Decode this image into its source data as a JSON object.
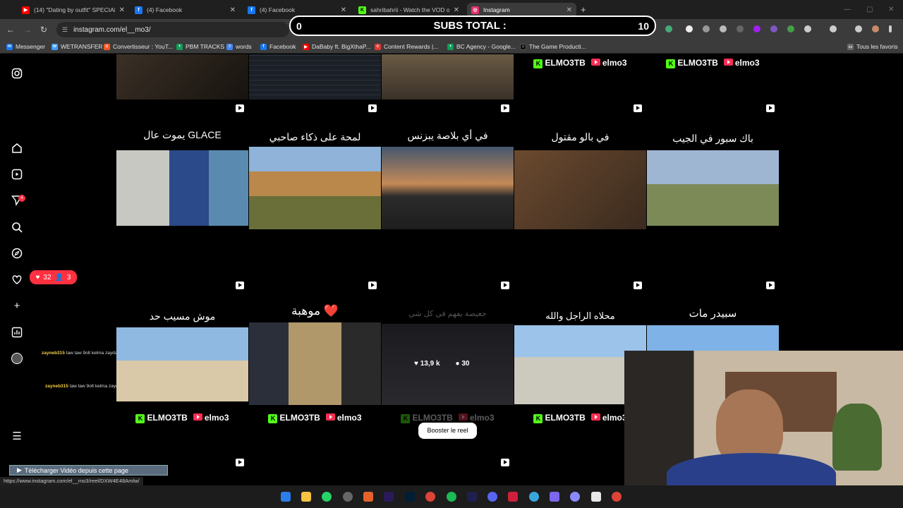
{
  "tabs": [
    {
      "title": "(14) \"Dating by outfit\" SPECIAL",
      "favicon_color": "#ff0000",
      "active": false
    },
    {
      "title": "(4) Facebook",
      "favicon_color": "#1877f2",
      "active": false
    },
    {
      "title": "(4) Facebook",
      "favicon_color": "#1877f2",
      "active": false
    },
    {
      "title": "sahribahrii - Watch the VOD on",
      "favicon_color": "#53fc18",
      "active": false
    },
    {
      "title": "Instagram",
      "favicon_color": "#e1306c",
      "active": true
    }
  ],
  "url": "instagram.com/el__mo3/",
  "subs_overlay": {
    "left": "0",
    "label": "SUBS TOTAL :",
    "right": "10"
  },
  "bookmarks": [
    {
      "label": "Messenger",
      "color": "#1877f2"
    },
    {
      "label": "WETRANSFER",
      "color": "#409fff"
    },
    {
      "label": "Convertisseur : YouT...",
      "color": "#ff5722"
    },
    {
      "label": "PBM TRACKS",
      "color": "#0f9d58"
    },
    {
      "label": "words",
      "color": "#4285f4"
    },
    {
      "label": "Facebook",
      "color": "#1877f2"
    },
    {
      "label": "DaBaby ft. BigXthaP...",
      "color": "#ff0000"
    },
    {
      "label": "Content Rewards |...",
      "color": "#e53935"
    },
    {
      "label": "BC Agency - Google...",
      "color": "#0f9d58"
    },
    {
      "label": "The Game Producti...",
      "color": "#111111"
    }
  ],
  "all_bookmarks": "Tous les favoris",
  "notif_pill": {
    "likes": "32",
    "followers": "3"
  },
  "sidebar_badge": "4",
  "brand": {
    "kick": "ELMO3TB",
    "yt": "elmo3"
  },
  "posts_row1": [
    {
      "caption": ""
    },
    {
      "caption": ""
    },
    {
      "caption": ""
    },
    {
      "caption": ""
    },
    {
      "caption": ""
    }
  ],
  "posts_row2": [
    {
      "caption": "يموت عال GLACE"
    },
    {
      "caption": "لمحة على ذكاء صاحبي"
    },
    {
      "caption": "في أي بلاصة يبزنس"
    },
    {
      "caption": "في بالو مقتول"
    },
    {
      "caption": "باك سبور في الجيب"
    }
  ],
  "posts_row3": [
    {
      "caption": "موش مسيب حد"
    },
    {
      "caption": "موهبة ❤️"
    },
    {
      "caption": "جعيصة يفهم في كل شي"
    },
    {
      "caption": "محلاه الراجل والله"
    },
    {
      "caption": "سبيدر مات"
    }
  ],
  "hover_stats": {
    "likes": "13,9 k",
    "comments": "30"
  },
  "boost_label": "Booster le reel",
  "chat": [
    {
      "user": "zayneb315",
      "msg": "taw taw 9olt kelma zaydaaa"
    },
    {
      "user": "zayneb315",
      "msg": "taw taw 9olt kelma zaydaaa"
    }
  ],
  "download_bar": "Télécharger Vidéo depuis cette page",
  "status_url": "https://www.instagram.com/el__mo3/reel/DXW4E48Amlw/"
}
